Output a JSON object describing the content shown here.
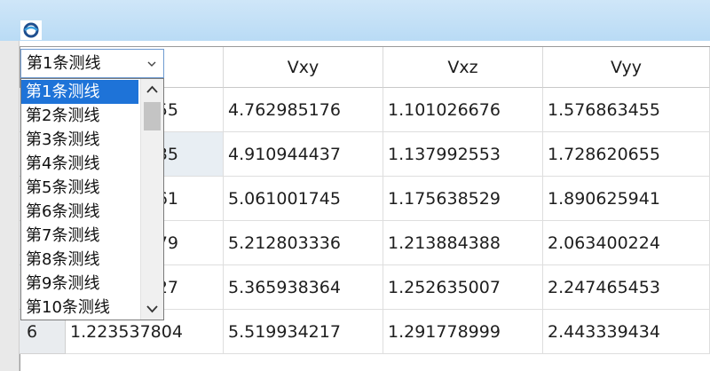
{
  "window": {
    "icon": "app-logo-icon"
  },
  "table": {
    "columns": [
      "Vxy",
      "Vxz",
      "Vyy"
    ],
    "rows": [
      {
        "index": "",
        "first": "55",
        "vxy": "4.762985176",
        "vxz": "1.101026676",
        "vyy": "1.576863455"
      },
      {
        "index": "",
        "first": "35",
        "vxy": "4.910944437",
        "vxz": "1.137992553",
        "vyy": "1.728620655"
      },
      {
        "index": "",
        "first": "61",
        "vxy": "5.061001745",
        "vxz": "1.175638529",
        "vyy": "1.890625941"
      },
      {
        "index": "",
        "first": "79",
        "vxy": "5.212803336",
        "vxz": "1.213884388",
        "vyy": "2.063400224"
      },
      {
        "index": "",
        "first": "27",
        "vxy": "5.365938364",
        "vxz": "1.252635007",
        "vyy": "2.247465453"
      },
      {
        "index": "6",
        "first": "1.223537804",
        "vxy": "5.519934217",
        "vxz": "1.291778999",
        "vyy": "2.443339434"
      }
    ]
  },
  "combo": {
    "selected": "第1条测线",
    "options": [
      "第1条测线",
      "第2条测线",
      "第3条测线",
      "第4条测线",
      "第5条测线",
      "第6条测线",
      "第7条测线",
      "第8条测线",
      "第9条测线",
      "第10条测线"
    ],
    "selected_index": 0
  },
  "colors": {
    "selection": "#1e73d8",
    "titlebar": "#c6e1f7"
  }
}
